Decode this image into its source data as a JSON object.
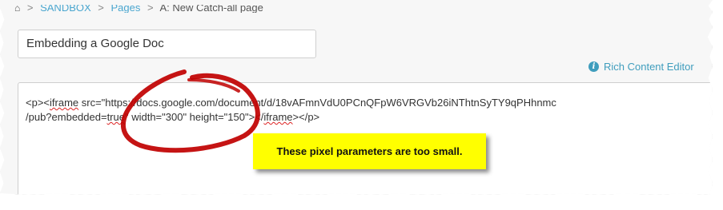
{
  "breadcrumb": {
    "home_icon": "home-icon",
    "items": [
      "SANDBOX",
      "Pages",
      "A: New Catch-all page"
    ],
    "separator": ">"
  },
  "title_field": {
    "value": "Embedding a Google Doc"
  },
  "rich_editor_link": {
    "icon": "info-icon",
    "label": "Rich Content Editor"
  },
  "editor": {
    "line1_a": "<p><",
    "line1_iframe": "iframe",
    "line1_b": " src=\"https://docs.google.com/document/d/18vAFmnVdU0PCnQFpW6VRGVb26iNThtnSyTY9qPHhnmc",
    "line2_a": "/pub?embedded=",
    "line2_true": "true",
    "line2_b": "\" width=\"300\" height=\"150\"></",
    "line2_iframe": "iframe",
    "line2_c": "></p>"
  },
  "annotation": {
    "callout_text": "These pixel parameters are too small.",
    "callout_color": "#ffff00",
    "circle_color": "#c00000"
  },
  "colors": {
    "link": "#4aa6cf",
    "accent": "#3f9dbd"
  }
}
